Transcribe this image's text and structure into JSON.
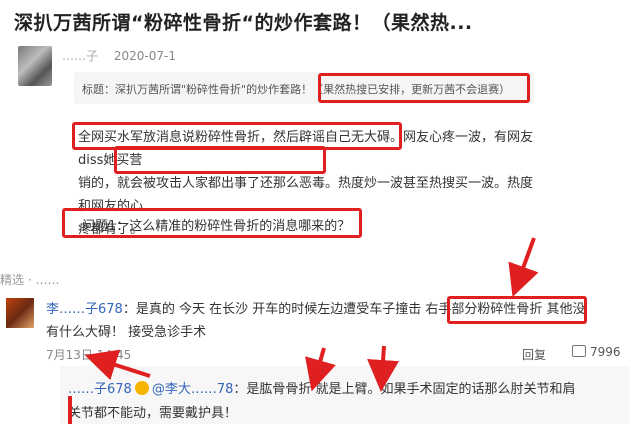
{
  "article": {
    "title": "深扒万茜所谓“粉碎性骨折“的炒作套路！（果然热...",
    "author": "……子",
    "date": "2020-07-1",
    "quote": "标题：深扒万茜所谓\"粉碎性骨折\"的炒作套路！（果然热搜已安排，更新万茜不会退赛）",
    "body_line1": "全网买水军放消息说粉碎性骨折，然后辟谣自己无大碍。网友心疼一波，有网友diss她买营",
    "body_line2": "销的，就会被攻击人家都出事了还那么恶毒。热度炒一波甚至热搜买一波。热度和网友的心",
    "body_line3": "疼都有了。",
    "question": "问题1：这么精准的粉碎性骨折的消息哪来的？"
  },
  "divider": "精选 · ……",
  "comment": {
    "user": "李……子678",
    "line1": "：是真的 今天 在长沙 开车的时候左边遭受车子撞击 右手部分粉碎性骨折 其他没",
    "line2": "有什么大碍！ 接受急诊手术",
    "time": "7月13日 14:45",
    "reply_label": "回复",
    "likes": "7996"
  },
  "reply": {
    "user": "……子678",
    "mention": "@李大……78",
    "line1": "：是肱骨骨折 就是上臂。如果手术固定的话那么肘关节和肩",
    "line2": "关节都不能动，需要戴护具！"
  },
  "colors": {
    "highlight": "#e02020",
    "link": "#3366bb"
  }
}
